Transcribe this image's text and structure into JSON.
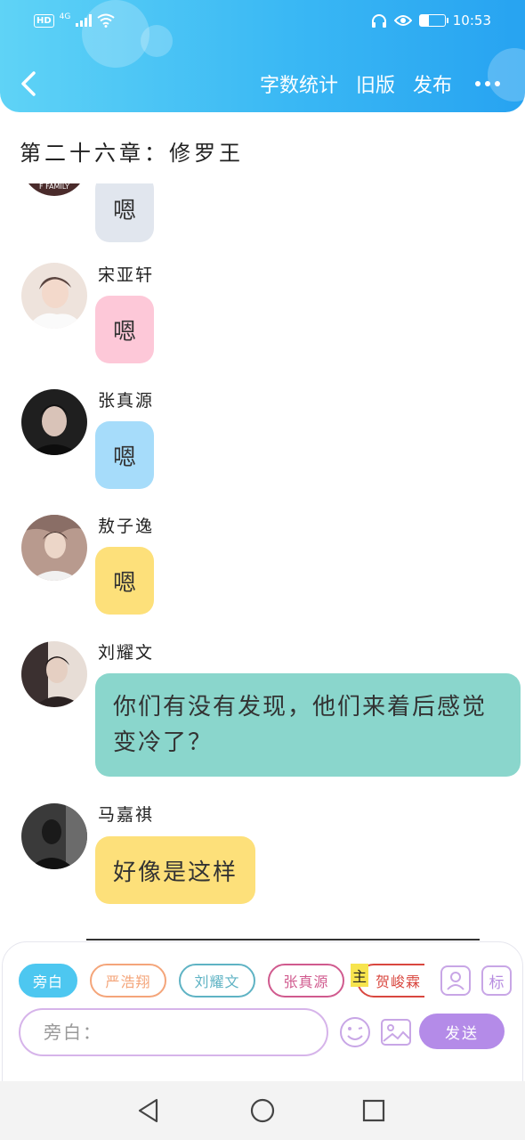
{
  "status_bar": {
    "hd": "HD",
    "network": "4G",
    "time": "10:53",
    "battery_level": 0.35
  },
  "header": {
    "word_count_label": "字数统计",
    "old_version_label": "旧版",
    "publish_label": "发布"
  },
  "chapter_title": "第二十六章：修罗王",
  "messages": [
    {
      "sender": "",
      "text": "嗯",
      "bubble_color": "#e1e6ee",
      "avatar_color": "#4a2b2b"
    },
    {
      "sender": "宋亚轩",
      "text": "嗯",
      "bubble_color": "#fdc8d8",
      "avatar_color": "#e8d8cf"
    },
    {
      "sender": "张真源",
      "text": "嗯",
      "bubble_color": "#a6dcfa",
      "avatar_color": "#2a2a2a"
    },
    {
      "sender": "敖子逸",
      "text": "嗯",
      "bubble_color": "#fde07a",
      "avatar_color": "#b79a8c"
    },
    {
      "sender": "刘耀文",
      "text": "你们有没有发现，他们来着后感觉变冷了？",
      "bubble_color": "#8ad6cc",
      "avatar_color": "#3b3030"
    },
    {
      "sender": "马嘉祺",
      "text": "好像是这样",
      "bubble_color": "#fde07a",
      "avatar_color": "#2b2b2b"
    }
  ],
  "characters": [
    {
      "name": "旁白",
      "color": "#4dc7f0"
    },
    {
      "name": "严浩翔",
      "color": "#f4a57a"
    },
    {
      "name": "刘耀文",
      "color": "#5fb3c4"
    },
    {
      "name": "张真源",
      "color": "#d05a8e"
    },
    {
      "name": "贺峻霖",
      "color": "#d9473f"
    }
  ],
  "main_tag": "主",
  "mark_button_label": "标",
  "input": {
    "placeholder": "旁白："
  },
  "send_label": "发送",
  "colors": {
    "header_start": "#5fd3f6",
    "header_end": "#27a3f1",
    "send_button": "#b48be8"
  },
  "icons": [
    "back-icon",
    "more-icon",
    "person-icon",
    "emoji-icon",
    "image-icon",
    "nav-back-icon",
    "nav-home-icon",
    "nav-recents-icon"
  ]
}
